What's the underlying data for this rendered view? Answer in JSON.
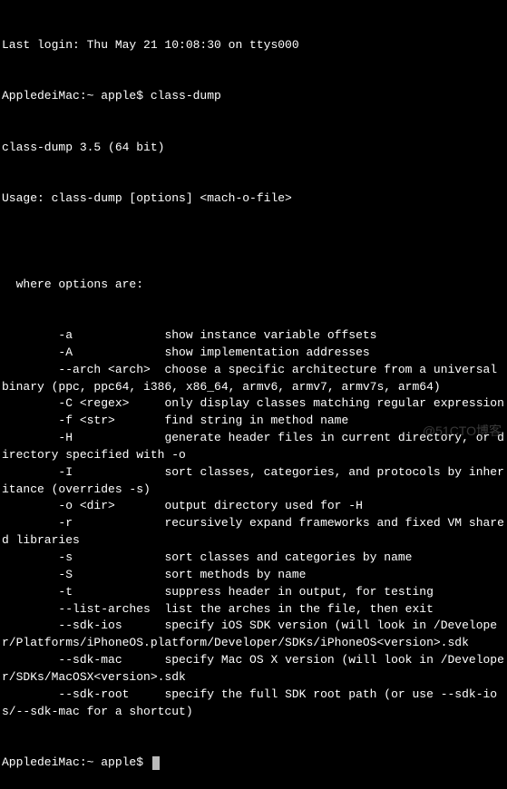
{
  "login_line": "Last login: Thu May 21 10:08:30 on ttys000",
  "prompt1": "AppledeiMac:~ apple$ ",
  "command1": "class-dump",
  "version": "class-dump 3.5 (64 bit)",
  "usage": "Usage: class-dump [options] <mach-o-file>",
  "blank": "",
  "opts_header": "  where options are:",
  "options": [
    {
      "flag": "        -a             ",
      "desc": "show instance variable offsets"
    },
    {
      "flag": "        -A             ",
      "desc": "show implementation addresses"
    },
    {
      "flag": "        --arch <arch>  ",
      "desc": "choose a specific architecture from a universal binary (ppc, ppc64, i386, x86_64, armv6, armv7, armv7s, arm64)"
    },
    {
      "flag": "        -C <regex>     ",
      "desc": "only display classes matching regular expression"
    },
    {
      "flag": "        -f <str>       ",
      "desc": "find string in method name"
    },
    {
      "flag": "        -H             ",
      "desc": "generate header files in current directory, or directory specified with -o"
    },
    {
      "flag": "        -I             ",
      "desc": "sort classes, categories, and protocols by inheritance (overrides -s)"
    },
    {
      "flag": "        -o <dir>       ",
      "desc": "output directory used for -H"
    },
    {
      "flag": "        -r             ",
      "desc": "recursively expand frameworks and fixed VM shared libraries"
    },
    {
      "flag": "        -s             ",
      "desc": "sort classes and categories by name"
    },
    {
      "flag": "        -S             ",
      "desc": "sort methods by name"
    },
    {
      "flag": "        -t             ",
      "desc": "suppress header in output, for testing"
    },
    {
      "flag": "        --list-arches  ",
      "desc": "list the arches in the file, then exit"
    },
    {
      "flag": "        --sdk-ios      ",
      "desc": "specify iOS SDK version (will look in /Developer/Platforms/iPhoneOS.platform/Developer/SDKs/iPhoneOS<version>.sdk"
    },
    {
      "flag": "        --sdk-mac      ",
      "desc": "specify Mac OS X version (will look in /Developer/SDKs/MacOSX<version>.sdk"
    },
    {
      "flag": "        --sdk-root     ",
      "desc": "specify the full SDK root path (or use --sdk-ios/--sdk-mac for a shortcut)"
    }
  ],
  "prompt2": "AppledeiMac:~ apple$ ",
  "watermark": "@51CTO博客"
}
